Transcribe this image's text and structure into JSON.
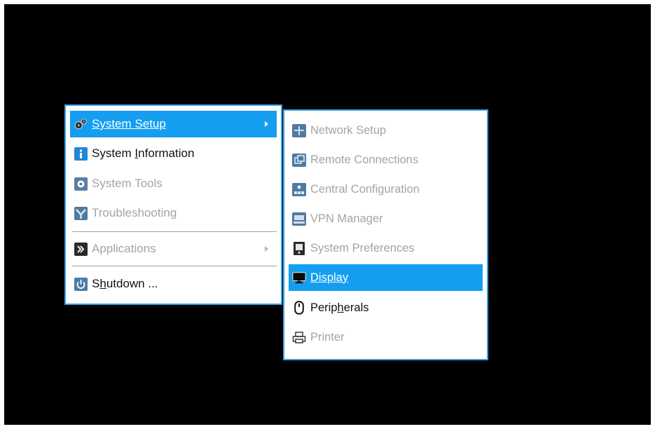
{
  "main_menu": {
    "items": [
      {
        "label": "System Setup",
        "icon": "gears-icon",
        "selected": true,
        "submenu": true
      },
      {
        "label_pre": "System ",
        "label_mnemonic": "I",
        "label_post": "nformation",
        "icon": "info-icon"
      },
      {
        "label": "System Tools",
        "icon": "tools-icon",
        "disabled": true
      },
      {
        "label": "Troubleshooting",
        "icon": "troubleshooting-icon",
        "disabled": true
      },
      {
        "label": "Applications",
        "icon": "applications-icon",
        "disabled": true,
        "submenu": true
      },
      {
        "label_pre": "S",
        "label_mnemonic": "h",
        "label_post": "utdown ...",
        "icon": "power-icon"
      }
    ]
  },
  "sub_menu": {
    "items": [
      {
        "label": "Network Setup",
        "icon": "network-icon",
        "disabled": true
      },
      {
        "label": "Remote Connections",
        "icon": "remote-connections-icon",
        "disabled": true
      },
      {
        "label": "Central Configuration",
        "icon": "central-configuration-icon",
        "disabled": true
      },
      {
        "label": "VPN Manager",
        "icon": "vpn-icon",
        "disabled": true
      },
      {
        "label": "System Preferences",
        "icon": "preferences-icon",
        "disabled": true
      },
      {
        "label": "Display",
        "icon": "monitor-icon",
        "selected": true
      },
      {
        "label_pre": "Perip",
        "label_mnemonic": "h",
        "label_post": "erals",
        "icon": "mouse-icon"
      },
      {
        "label": "Printer",
        "icon": "printer-icon",
        "disabled": true
      }
    ]
  },
  "colors": {
    "background": "#000000",
    "menu_border": "#3aa1e6",
    "selection": "#149ef0",
    "disabled_text": "#a4a4a4"
  }
}
